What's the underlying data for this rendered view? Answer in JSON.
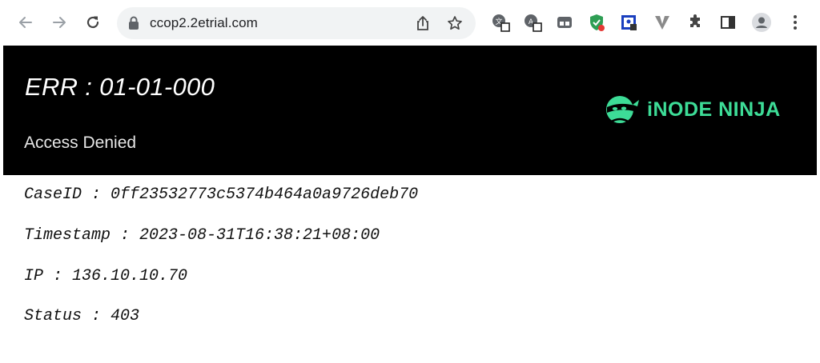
{
  "browser": {
    "url": "ccop2.2etrial.com",
    "extensions": [
      "translate-extension-icon",
      "translate-extension-icon-2",
      "tab-manager-extension-icon",
      "shield-extension-icon",
      "portrait-extension-icon",
      "v-extension-icon",
      "puzzle-icon",
      "sidebar-icon",
      "profile-avatar-icon",
      "more-menu-icon"
    ]
  },
  "page": {
    "error_code": "ERR : 01-01-000",
    "error_message": "Access Denied",
    "brand_name": "iNODE NINJA",
    "brand_color": "#3ddc97",
    "details": [
      {
        "label": "CaseID",
        "value": "0ff23532773c5374b464a0a9726deb70",
        "text": "CaseID : 0ff23532773c5374b464a0a9726deb70"
      },
      {
        "label": "Timestamp",
        "value": "2023-08-31T16:38:21+08:00",
        "text": "Timestamp : 2023-08-31T16:38:21+08:00"
      },
      {
        "label": "IP",
        "value": "136.10.10.70",
        "text": "IP : 136.10.10.70"
      },
      {
        "label": "Status",
        "value": "403",
        "text": "Status : 403"
      }
    ]
  }
}
